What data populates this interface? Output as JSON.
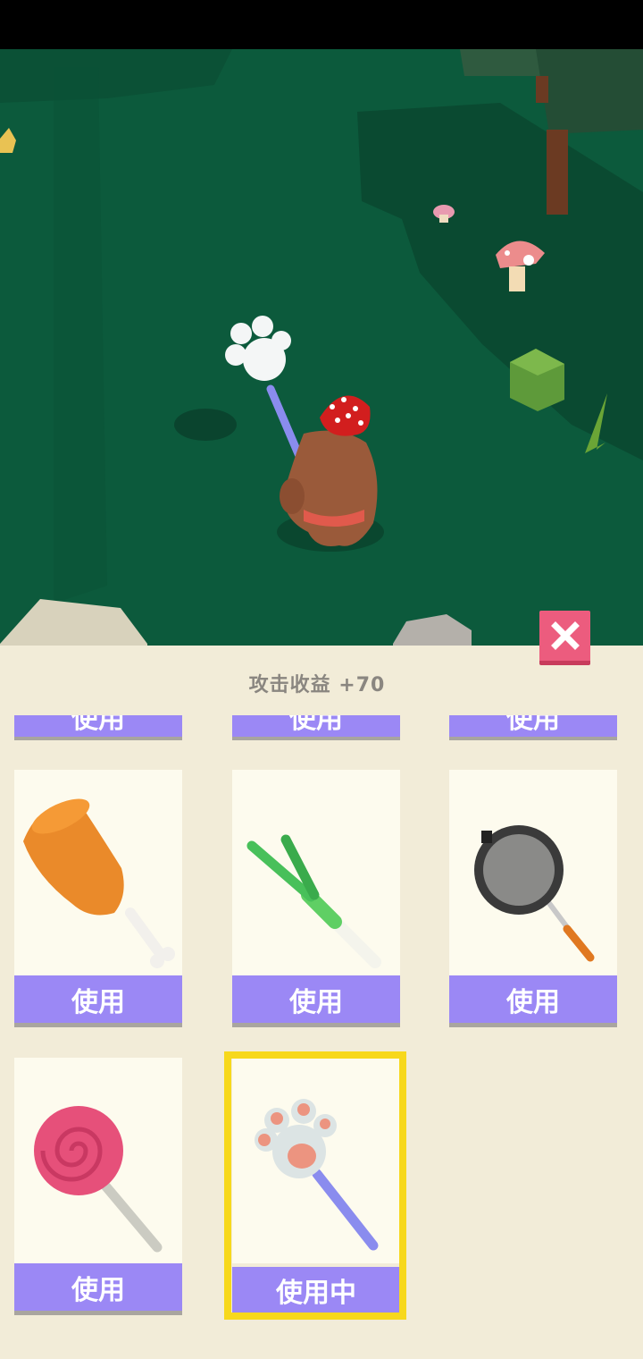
{
  "earnings": {
    "label": "攻击收益 +70"
  },
  "previous_row": {
    "labels": [
      "使用",
      "使用",
      "使用"
    ]
  },
  "weapons": [
    {
      "name": "drumstick-icon",
      "label": "使用",
      "selected": false
    },
    {
      "name": "leek-icon",
      "label": "使用",
      "selected": false
    },
    {
      "name": "frying-pan-icon",
      "label": "使用",
      "selected": false
    },
    {
      "name": "lollipop-icon",
      "label": "使用",
      "selected": false
    },
    {
      "name": "cat-paw-wand-icon",
      "label": "使用中",
      "selected": true
    }
  ],
  "colors": {
    "grass": "#0c5a3c",
    "panel": "#f2ecd8",
    "button": "#9b88f5",
    "close": "#ec5c7e",
    "selected_frame": "#f7d81c"
  }
}
